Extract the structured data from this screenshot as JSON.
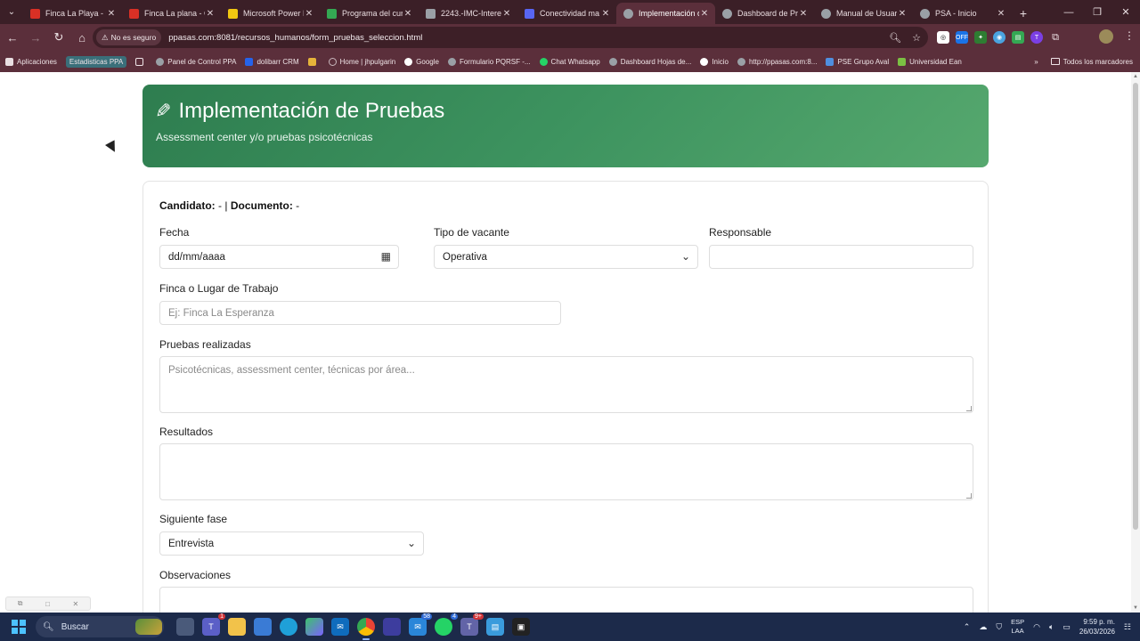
{
  "browser": {
    "tabs": [
      {
        "label": "Finca La Playa - G",
        "favicon_color": "#d93025",
        "active": false
      },
      {
        "label": "Finca La plana - G",
        "favicon_color": "#d93025",
        "active": false
      },
      {
        "label": "Microsoft Power B",
        "favicon_color": "#f2c811",
        "active": false
      },
      {
        "label": "Programa del cur",
        "favicon_color": "#34a853",
        "active": false
      },
      {
        "label": "2243.-IMC-Intere",
        "favicon_color": "#9aa0a6",
        "active": false
      },
      {
        "label": "Conectividad ma",
        "favicon_color": "#5865f2",
        "active": false
      },
      {
        "label": "Implementación d",
        "favicon_color": "#9aa0a6",
        "active": true
      },
      {
        "label": "Dashboard de Pr",
        "favicon_color": "#9aa0a6",
        "active": false
      },
      {
        "label": "Manual de Usuari",
        "favicon_color": "#9aa0a6",
        "active": false
      },
      {
        "label": "PSA - Inicio",
        "favicon_color": "#9aa0a6",
        "active": false
      }
    ],
    "security_chip": "No es seguro",
    "url": "ppasas.com:8081/recursos_humanos/form_pruebas_seleccion.html",
    "bookmarks": [
      {
        "label": "Aplicaciones",
        "color": "#9aa0a6",
        "chip": false
      },
      {
        "label": "Estadisticas PPA",
        "color": "",
        "chip": true
      },
      {
        "label": "",
        "color": "#cfcfcf",
        "chip": false
      },
      {
        "label": "Panel de Control PPA",
        "color": "#9aa0a6",
        "chip": false
      },
      {
        "label": "dolibarr CRM",
        "color": "#2563eb",
        "chip": false
      },
      {
        "label": "",
        "color": "#e5b33a",
        "chip": false
      },
      {
        "label": "Home | jhpulgarin",
        "color": "#6b4a55",
        "chip": false
      },
      {
        "label": "Google",
        "color": "#ffffff",
        "chip": false
      },
      {
        "label": "Formulario PQRSF -...",
        "color": "#9aa0a6",
        "chip": false
      },
      {
        "label": "Chat Whatsapp",
        "color": "#25d366",
        "chip": false
      },
      {
        "label": "Dashboard Hojas de...",
        "color": "#9aa0a6",
        "chip": false
      },
      {
        "label": "Inicio",
        "color": "#ffffff",
        "chip": false
      },
      {
        "label": "http://ppasas.com:8...",
        "color": "#9aa0a6",
        "chip": false
      },
      {
        "label": "PSE Grupo Aval",
        "color": "#4f8fe0",
        "chip": false
      },
      {
        "label": "Universidad Ean",
        "color": "#7bc043",
        "chip": false
      }
    ],
    "bookmarks_more": "»",
    "all_bookmarks": "Todos los marcadores"
  },
  "header": {
    "title": "Implementación de Pruebas",
    "subtitle": "Assessment center y/o pruebas psicotécnicas"
  },
  "form": {
    "candidate_label": "Candidato:",
    "candidate_value": "-",
    "separator": "|",
    "document_label": "Documento:",
    "document_value": "-",
    "fecha_label": "Fecha",
    "fecha_value": "dd/mm/aaaa",
    "tipo_label": "Tipo de vacante",
    "tipo_value": "Operativa",
    "responsable_label": "Responsable",
    "responsable_value": "",
    "finca_label": "Finca o Lugar de Trabajo",
    "finca_placeholder": "Ej: Finca La Esperanza",
    "pruebas_label": "Pruebas realizadas",
    "pruebas_placeholder": "Psicotécnicas, assessment center, técnicas por área...",
    "resultados_label": "Resultados",
    "resultados_placeholder": "",
    "fase_label": "Siguiente fase",
    "fase_value": "Entrevista",
    "observaciones_label": "Observaciones"
  },
  "taskbar": {
    "search_label": "Buscar",
    "lang_top": "ESP",
    "lang_bottom": "LAA",
    "time": "9:59 p. m.",
    "date": "26/03/2026",
    "badges": {
      "teams": "1",
      "outlook_count": "58",
      "whatsapp": "4",
      "teams2": "9+"
    }
  }
}
